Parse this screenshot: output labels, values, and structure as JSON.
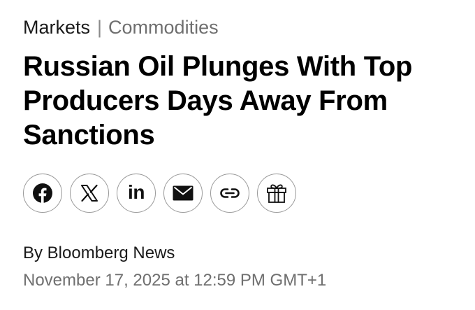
{
  "breadcrumb": {
    "category": "Markets",
    "separator": "|",
    "section": "Commodities"
  },
  "headline": "Russian Oil Plunges With Top Producers Days Away From Sanctions",
  "share_buttons": [
    {
      "icon": "facebook-icon"
    },
    {
      "icon": "x-icon"
    },
    {
      "icon": "linkedin-icon",
      "text": "in"
    },
    {
      "icon": "email-icon"
    },
    {
      "icon": "copy-link-icon"
    },
    {
      "icon": "gift-icon"
    }
  ],
  "byline": "By Bloomberg News",
  "timestamp": "November 17, 2025 at 12:59 PM GMT+1"
}
